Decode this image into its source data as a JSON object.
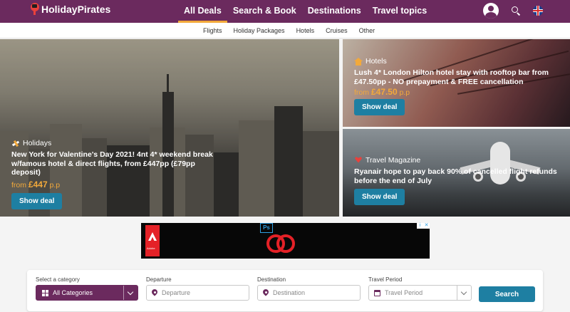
{
  "brand": {
    "name": "HolidayPirates"
  },
  "nav": {
    "items": [
      {
        "label": "All Deals",
        "active": true
      },
      {
        "label": "Search & Book"
      },
      {
        "label": "Destinations"
      },
      {
        "label": "Travel topics"
      }
    ]
  },
  "subnav": {
    "items": [
      "Flights",
      "Holiday Packages",
      "Hotels",
      "Cruises",
      "Other"
    ]
  },
  "deals": {
    "ny": {
      "category": "Holidays",
      "title": "New York for Valentine's Day 2021! 4nt 4* weekend break w/famous hotel & direct flights, from £447pp (£79pp deposit)",
      "price_prefix": "from",
      "price": "£447",
      "price_suffix": "p.p",
      "button": "Show deal"
    },
    "hotel": {
      "category": "Hotels",
      "title": "Lush 4* London Hilton hotel stay with rooftop bar from £47.50pp - NO prepayment & FREE cancellation",
      "price_prefix": "from",
      "price": "£47.50",
      "price_suffix": "p.p",
      "button": "Show deal"
    },
    "magazine": {
      "category": "Travel Magazine",
      "title": "Ryanair hope to pay back 90% of cancelled flight refunds before the end of July",
      "button": "Show deal"
    }
  },
  "ad": {
    "brand_text": "Adobe",
    "ps_label": "Ps",
    "close_labels": [
      "i",
      "✕"
    ]
  },
  "search": {
    "category_label": "Select a category",
    "category_value": "All Categories",
    "departure_label": "Departure",
    "departure_placeholder": "Departure",
    "destination_label": "Destination",
    "destination_placeholder": "Destination",
    "period_label": "Travel Period",
    "period_placeholder": "Travel Period",
    "button": "Search"
  },
  "colors": {
    "brand": "#6b2a5e",
    "accent": "#f2a93b",
    "button": "#1e7fa2"
  }
}
